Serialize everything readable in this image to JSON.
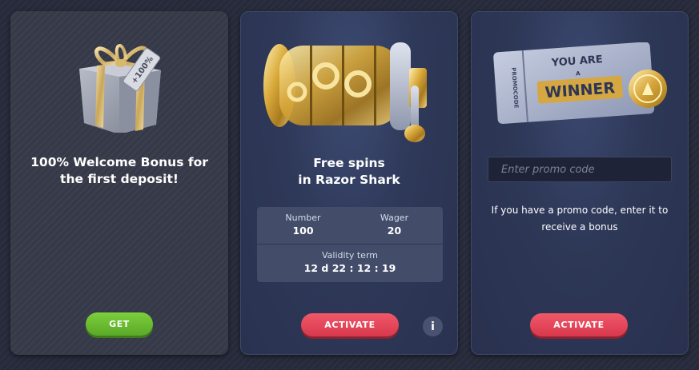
{
  "cards": [
    {
      "title_line1": "100% Welcome Bonus for",
      "title_line2": "the first deposit!",
      "tag_text": "+100%",
      "button_label": "GET",
      "button_color": "#6cbf32"
    },
    {
      "title_line1": "Free spins",
      "title_line2": "in Razor Shark",
      "number_label": "Number",
      "number_value": "100",
      "wager_label": "Wager",
      "wager_value": "20",
      "validity_label": "Validity term",
      "validity_value": "12 d 22 : 12 : 19",
      "button_label": "ACTIVATE",
      "button_color": "#e6475a",
      "info_label": "i"
    },
    {
      "ticket_side_text": "PROMOCODE",
      "ticket_line1": "YOU ARE",
      "ticket_line2": "A",
      "ticket_line3": "WINNER",
      "promo_placeholder": "Enter promo code",
      "description_line1": "If you have a promo code, enter it to",
      "description_line2": "receive a bonus",
      "button_label": "ACTIVATE",
      "button_color": "#e6475a"
    }
  ]
}
